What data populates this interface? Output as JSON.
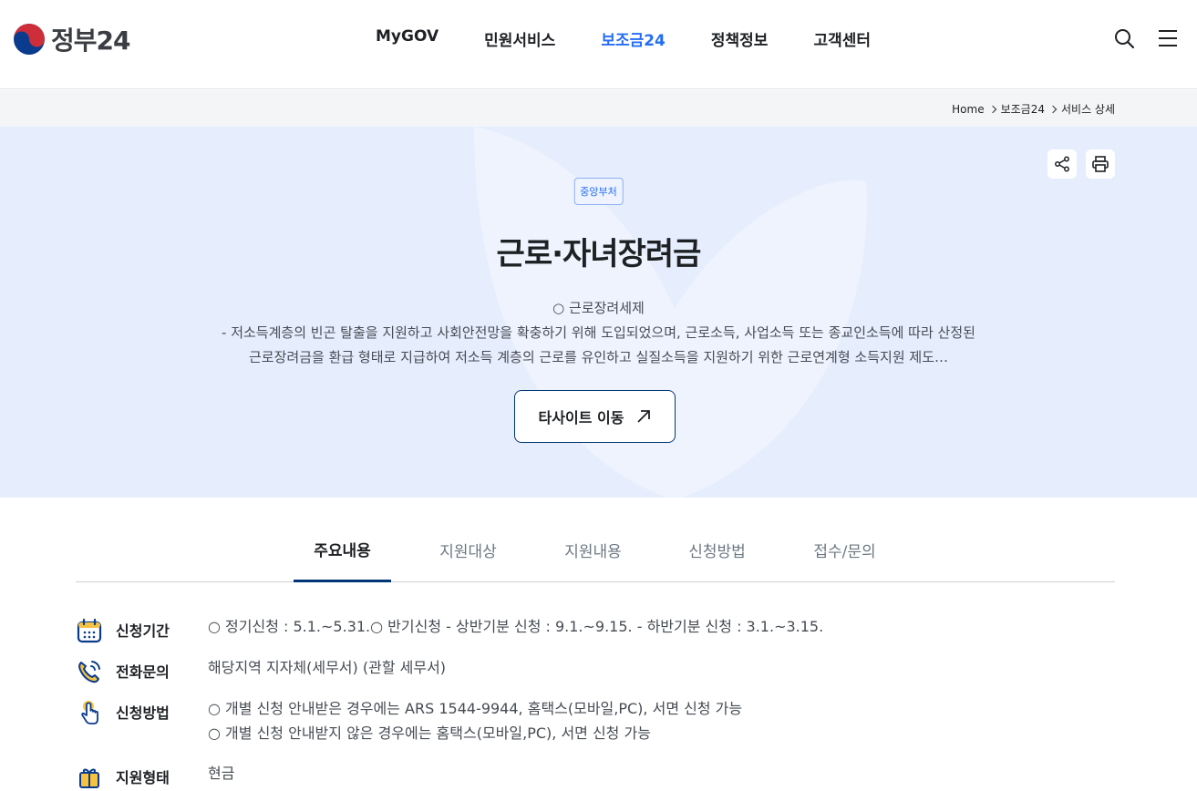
{
  "header": {
    "logo_text": "정부24",
    "nav": [
      "MyGOV",
      "민원서비스",
      "보조금24",
      "정책정보",
      "고객센터"
    ],
    "active_nav": "보조금24"
  },
  "breadcrumb": [
    "Home",
    "보조금24",
    "서비스 상세"
  ],
  "hero": {
    "badge": "중앙부처",
    "title": "근로·자녀장려금",
    "desc_line1": "○ 근로장려세제",
    "desc_line2": "- 저소득계층의 빈곤 탈출을 지원하고 사회안전망을 확충하기 위해 도입되었으며, 근로소득, 사업소득 또는 종교인소득에 따라 산정된",
    "desc_line3": "근로장려금을 환급 형태로 지급하여 저소득 계층의 근로를 유인하고 실질소득을 지원하기 위한 근로연계형 소득지원 제도…",
    "button_label": "타사이트 이동"
  },
  "tabs": [
    "주요내용",
    "지원대상",
    "지원내용",
    "신청방법",
    "접수/문의"
  ],
  "info": {
    "period_label": "신청기간",
    "period_value": "○ 정기신청 : 5.1.~5.31.○ 반기신청 - 상반기분 신청 : 9.1.~9.15. - 하반기분 신청 : 3.1.~3.15.",
    "phone_label": "전화문의",
    "phone_value": "해당지역 지자체(세무서) (관할 세무서)",
    "method_label": "신청방법",
    "method_value1": "○ 개별 신청 안내받은 경우에는 ARS 1544-9944, 홈택스(모바일,PC), 서면 신청 가능",
    "method_value2": "○ 개별 신청 안내받지 않은 경우에는 홈택스(모바일,PC), 서면 신청 가능",
    "type_label": "지원형태",
    "type_value": "현금"
  },
  "colors": {
    "accent": "#256ef4",
    "navy": "#003675",
    "hero_bg": "#e6eefe"
  }
}
